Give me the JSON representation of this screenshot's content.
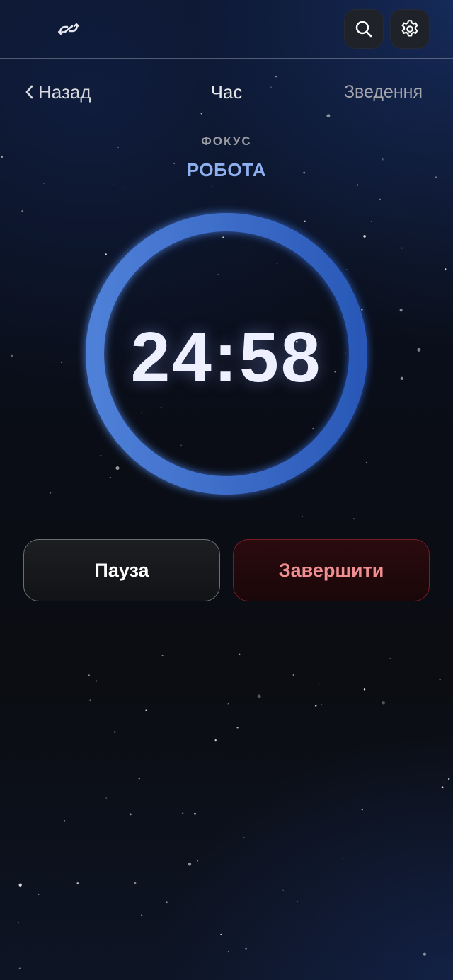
{
  "header": {
    "logo_icon": "link-sync-icon",
    "search_icon": "search-icon",
    "settings_icon": "gear-icon"
  },
  "nav": {
    "back_label": "Назад",
    "title": "Час",
    "summary_label": "Зведення"
  },
  "timer": {
    "mode_label": "ФОКУС",
    "mode_value": "РОБОТА",
    "time": "24:58",
    "progress_fraction": 1.0
  },
  "actions": {
    "pause_label": "Пауза",
    "finish_label": "Завершити"
  },
  "colors": {
    "accent": "#8fb0ef",
    "ring": "#3e70cf",
    "danger_text": "#f08e92",
    "danger_border": "#7a1c22"
  }
}
